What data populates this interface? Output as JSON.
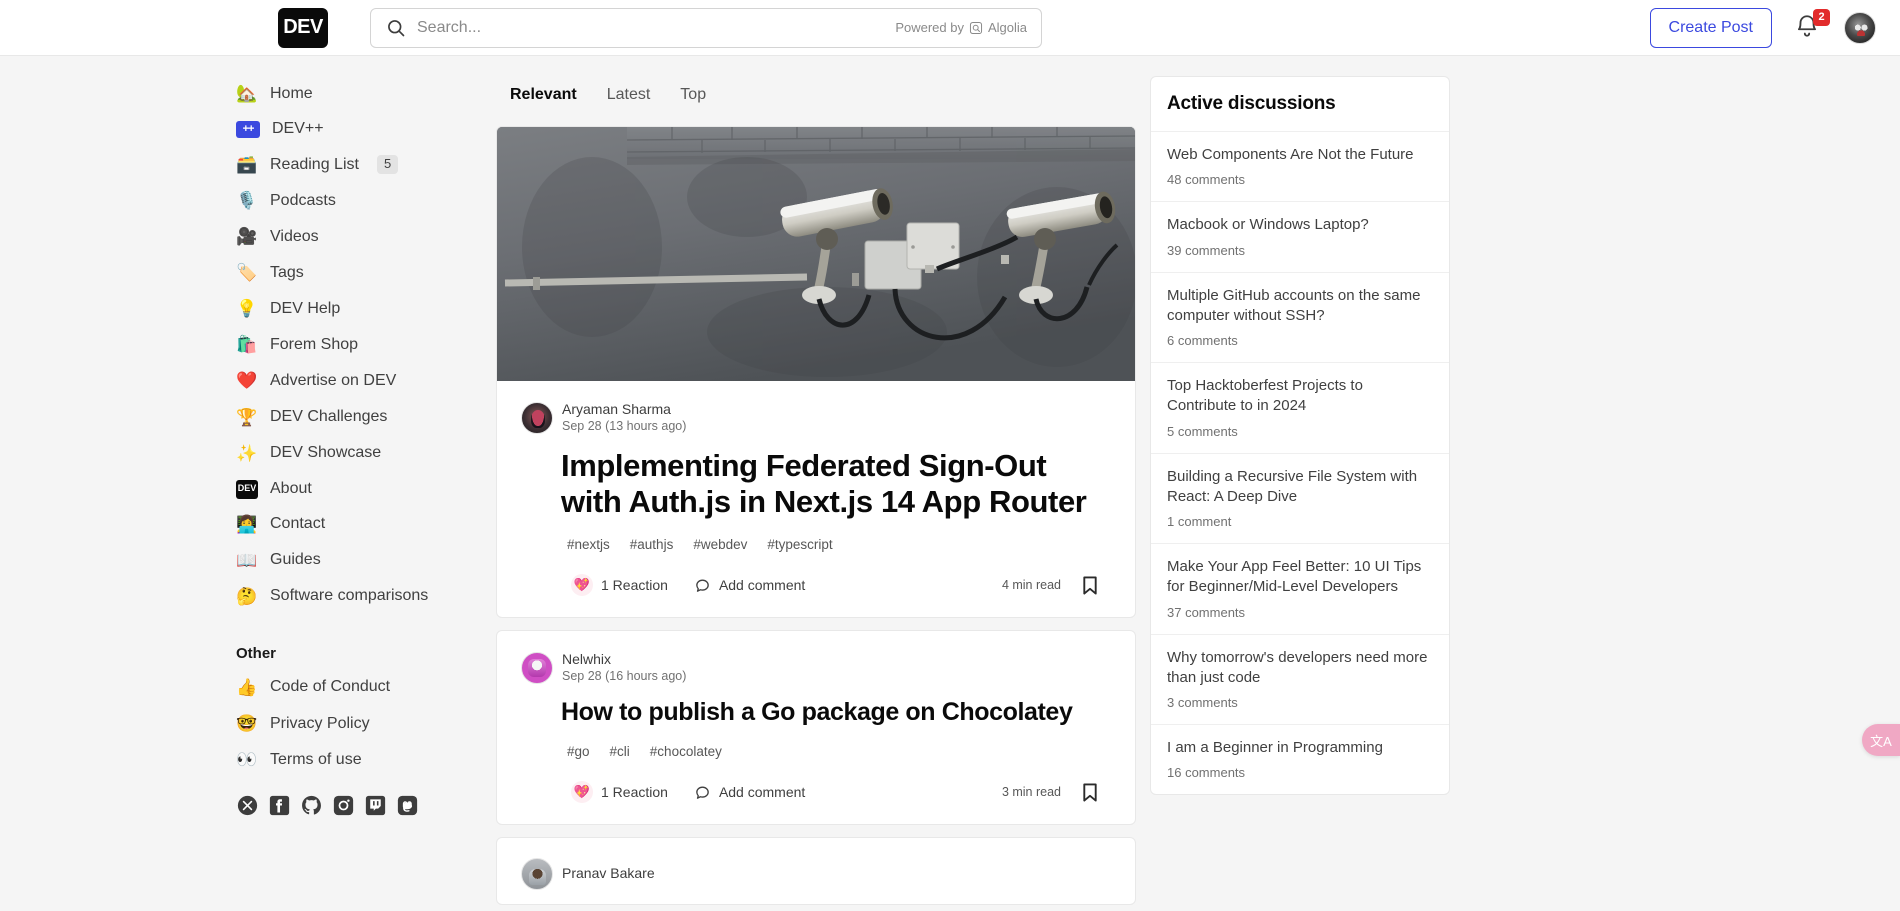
{
  "header": {
    "logo_text": "DEV",
    "search_placeholder": "Search...",
    "search_value": "",
    "powered_by": "Powered by",
    "algolia": "Algolia",
    "create_post_label": "Create Post",
    "notification_count": "2"
  },
  "sidebar": {
    "items": [
      {
        "emoji": "🏡",
        "label": "Home",
        "icon": "home-icon",
        "count": ""
      },
      {
        "emoji": "++",
        "label": "DEV++",
        "icon": "devpp-icon",
        "count": ""
      },
      {
        "emoji": "🗃️",
        "label": "Reading List",
        "icon": "reading-list-icon",
        "count": "5"
      },
      {
        "emoji": "🎙️",
        "label": "Podcasts",
        "icon": "podcast-icon",
        "count": ""
      },
      {
        "emoji": "🎥",
        "label": "Videos",
        "icon": "video-icon",
        "count": ""
      },
      {
        "emoji": "🏷️",
        "label": "Tags",
        "icon": "tag-icon",
        "count": ""
      },
      {
        "emoji": "💡",
        "label": "DEV Help",
        "icon": "lightbulb-icon",
        "count": ""
      },
      {
        "emoji": "🛍️",
        "label": "Forem Shop",
        "icon": "shop-icon",
        "count": ""
      },
      {
        "emoji": "❤️",
        "label": "Advertise on DEV",
        "icon": "heart-icon",
        "count": ""
      },
      {
        "emoji": "🏆",
        "label": "DEV Challenges",
        "icon": "trophy-icon",
        "count": ""
      },
      {
        "emoji": "✨",
        "label": "DEV Showcase",
        "icon": "sparkles-icon",
        "count": ""
      },
      {
        "emoji": "DEV",
        "label": "About",
        "icon": "dev-badge-icon",
        "count": ""
      },
      {
        "emoji": "👩‍💻",
        "label": "Contact",
        "icon": "contact-icon",
        "count": ""
      },
      {
        "emoji": "📖",
        "label": "Guides",
        "icon": "book-icon",
        "count": ""
      },
      {
        "emoji": "🤔",
        "label": "Software comparisons",
        "icon": "thinking-face-icon",
        "count": ""
      }
    ],
    "other_heading": "Other",
    "other_items": [
      {
        "emoji": "👍",
        "label": "Code of Conduct",
        "icon": "thumbs-up-icon"
      },
      {
        "emoji": "🤓",
        "label": "Privacy Policy",
        "icon": "nerd-face-icon"
      },
      {
        "emoji": "👀",
        "label": "Terms of use",
        "icon": "eyes-icon"
      }
    ],
    "social": [
      {
        "name": "twitter-x-icon",
        "label": "X"
      },
      {
        "name": "facebook-icon",
        "label": "Facebook"
      },
      {
        "name": "github-icon",
        "label": "GitHub"
      },
      {
        "name": "instagram-icon",
        "label": "Instagram"
      },
      {
        "name": "twitch-icon",
        "label": "Twitch"
      },
      {
        "name": "mastodon-icon",
        "label": "Mastodon"
      }
    ]
  },
  "feed": {
    "tabs": [
      {
        "label": "Relevant",
        "active": true
      },
      {
        "label": "Latest",
        "active": false
      },
      {
        "label": "Top",
        "active": false
      }
    ],
    "posts": [
      {
        "author": "Aryaman Sharma",
        "date": "Sep 28 (13 hours ago)",
        "title": "Implementing Federated Sign-Out with Auth.js in Next.js 14 App Router",
        "tags": [
          "#nextjs",
          "#authjs",
          "#webdev",
          "#typescript"
        ],
        "reactions": "1 Reaction",
        "comment_label": "Add comment",
        "read_time": "4 min read",
        "has_cover": true,
        "cover_alt": "Two CCTV security cameras mounted on a grey concrete wall"
      },
      {
        "author": "Nelwhix",
        "date": "Sep 28 (16 hours ago)",
        "title": "How to publish a Go package on Chocolatey",
        "tags": [
          "#go",
          "#cli",
          "#chocolatey"
        ],
        "reactions": "1 Reaction",
        "comment_label": "Add comment",
        "read_time": "3 min read",
        "has_cover": false
      },
      {
        "author": "Pranav Bakare",
        "date": "",
        "title": "",
        "tags": [],
        "reactions": "",
        "comment_label": "",
        "read_time": "",
        "has_cover": false
      }
    ]
  },
  "right_rail": {
    "title": "Active discussions",
    "discussions": [
      {
        "title": "Web Components Are Not the Future",
        "comments": "48 comments"
      },
      {
        "title": "Macbook or Windows Laptop?",
        "comments": "39 comments"
      },
      {
        "title": "Multiple GitHub accounts on the same computer without SSH?",
        "comments": "6 comments"
      },
      {
        "title": "Top Hacktoberfest Projects to Contribute to in 2024",
        "comments": "5 comments"
      },
      {
        "title": "Building a Recursive File System with React: A Deep Dive",
        "comments": "1 comment"
      },
      {
        "title": "Make Your App Feel Better: 10 UI Tips for Beginner/Mid-Level Developers",
        "comments": "37 comments"
      },
      {
        "title": "Why tomorrow's developers need more than just code",
        "comments": "3 comments"
      },
      {
        "title": "I am a Beginner in Programming",
        "comments": "16 comments"
      }
    ]
  },
  "floating": {
    "translate_label": "文A"
  },
  "colors": {
    "brand_blue": "#3b49df",
    "badge_red": "#e22b2b",
    "page_bg": "#f5f5f5",
    "card_bg": "#ffffff",
    "translate_pink": "#f0a8c4"
  }
}
